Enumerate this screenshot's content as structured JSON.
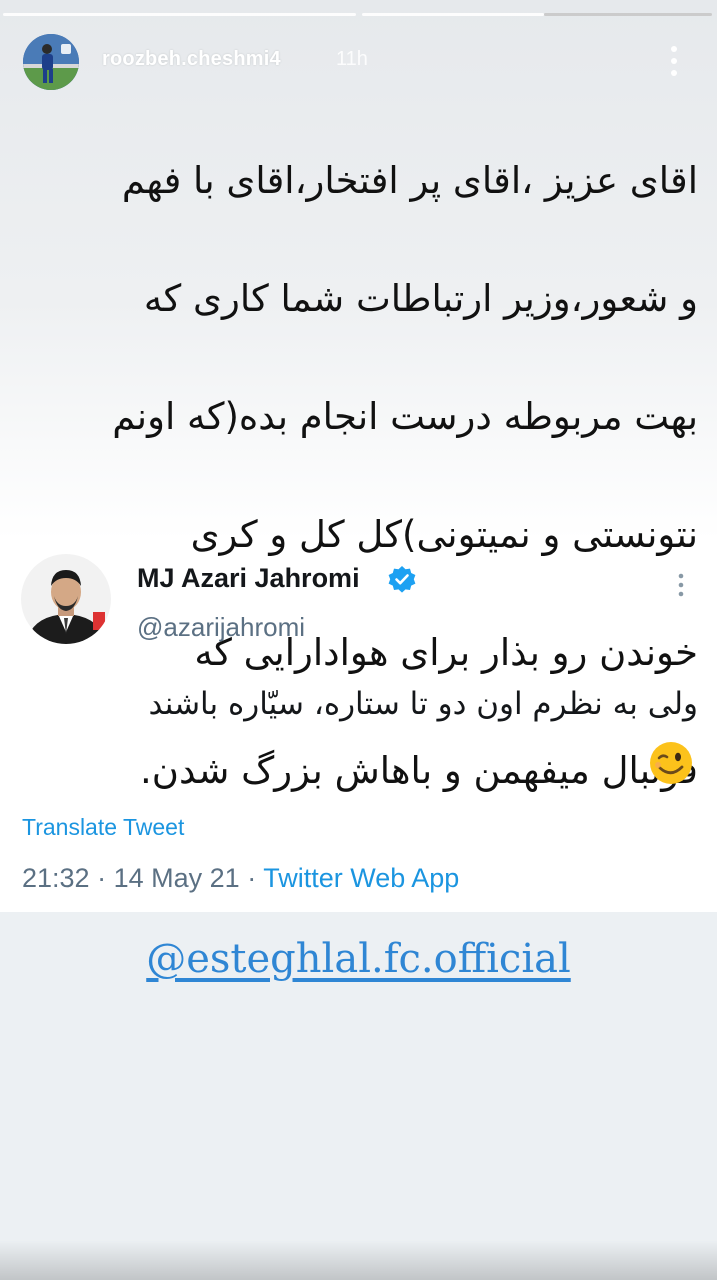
{
  "story": {
    "username": "roozbeh.cheshmi4",
    "time_ago": "11h",
    "progress": [
      1,
      1,
      0
    ],
    "caption_lines": [
      "اقای عزیز ،اقای پر افتخار،اقای با فهم",
      "و شعور،وزیر ارتباطات شما کاری که",
      "بهت مربوطه درست انجام بده(که اونم",
      "نتونستی و نمیتونی)کل کل و کری",
      "خوندن رو بذار برای هوادارایی که",
      "فوتبال میفهمن و باهاش بزرگ شدن."
    ],
    "mention": "@esteghlal.fc.official"
  },
  "tweet": {
    "display_name": "MJ Azari Jahromi",
    "handle": "@azarijahromi",
    "text": "ولی به نظرم اون دو تا ستاره، سیّاره باشند",
    "translate_label": "Translate Tweet",
    "time": "21:32",
    "date": "14 May 21",
    "source": "Twitter Web App",
    "separator": "·"
  },
  "icons": {
    "verified": "verified-badge-icon",
    "more": "more-vertical-icon",
    "wink": "winking-face-emoji"
  },
  "colors": {
    "twitter_blue": "#1b95e0",
    "verified_blue": "#1da1f2",
    "mention_blue": "#2f86d4"
  }
}
